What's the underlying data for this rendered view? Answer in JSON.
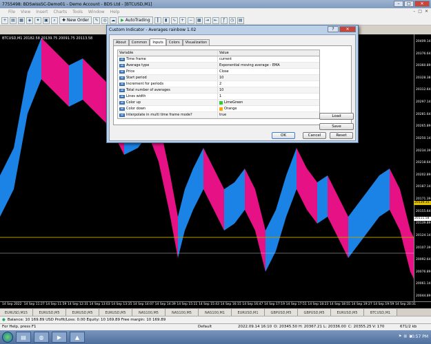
{
  "window": {
    "title": "7755498: BDSwissSC-Demo01 - Demo Account - BDS Ltd - [BTCUSD,M1]"
  },
  "menu": {
    "items": [
      "File",
      "View",
      "Insert",
      "Charts",
      "Tools",
      "Window",
      "Help"
    ]
  },
  "toolbar": {
    "new_order": "New Order",
    "autotrading": "AutoTrading"
  },
  "chart": {
    "label": "BTCUSD,M1  20182.58 20139.75 20091.75 20113.58",
    "price_ticks": [
      "20409.14",
      "20376.64",
      "20360.89",
      "20328.38",
      "20312.64",
      "20297.14",
      "20281.64",
      "20265.89",
      "20250.14",
      "20234.39",
      "20218.64",
      "20202.89",
      "20187.14",
      "20171.39",
      "20155.64",
      "20139.89",
      "20124.14",
      "20107.39",
      "20092.64",
      "20076.89",
      "20061.14",
      "20044.89"
    ],
    "price_tag_yellow": "20139.15",
    "price_tag_white": "20111.58",
    "time_ticks": [
      "14 Sep 2022",
      "14 Sep 11:27",
      "14 Sep 11:59",
      "14 Sep 12:31",
      "14 Sep 13:03",
      "14 Sep 13:35",
      "14 Sep 14:07",
      "14 Sep 14:39",
      "14 Sep 15:11",
      "14 Sep 15:43",
      "14 Sep 16:15",
      "14 Sep 16:47",
      "14 Sep 17:19",
      "14 Sep 17:51",
      "14 Sep 18:23",
      "14 Sep 18:55",
      "14 Sep 19:27",
      "14 Sep 19:59",
      "14 Sep 20:31"
    ],
    "colors": {
      "up": "#1e90ff",
      "down": "#ff1493",
      "yellow_line": "#b8a000"
    }
  },
  "dialog": {
    "title": "Custom Indicator - Averages rainbow 1.02",
    "tabs": [
      "About",
      "Common",
      "Inputs",
      "Colors",
      "Visualization"
    ],
    "active_tab": "Inputs",
    "grid_header": {
      "variable": "Variable",
      "value": "Value"
    },
    "rows": [
      {
        "variable": "Time frame",
        "value": "current"
      },
      {
        "variable": "Average type",
        "value": "Exponential moving average - EMA"
      },
      {
        "variable": "Price",
        "value": "Close"
      },
      {
        "variable": "Start period",
        "value": "10"
      },
      {
        "variable": "Increment for periods",
        "value": "2"
      },
      {
        "variable": "Total number of averages",
        "value": "10"
      },
      {
        "variable": "Lines width",
        "value": "1"
      },
      {
        "variable": "Color up",
        "value": "LimeGreen",
        "color": "#32cd32"
      },
      {
        "variable": "Color down",
        "value": "Orange",
        "color": "#ffa500"
      },
      {
        "variable": "Interpolate in multi time frame mode?",
        "value": "true"
      }
    ],
    "load": "Load",
    "save": "Save",
    "ok": "OK",
    "cancel": "Cancel",
    "reset": "Reset"
  },
  "symbol_tabs": [
    "EURUSD,M15",
    "EURUSD,M5",
    "EURUSD,M5",
    "EURUSD,M5",
    "NAS100,M5",
    "NAS100,M5",
    "NAS100,M1",
    "EURUSD,M1",
    "GBPUSD,M5",
    "GBPUSD,M5",
    "EURUSD,M5",
    "BTCUSD,M1"
  ],
  "balance": {
    "text": "Balance: 10 169.89 USD  Profit/Loss: 0.00  Equity: 10 169.89  Free margin: 10 169.89"
  },
  "status": {
    "help": "For Help, press F1",
    "profile": "Default",
    "datetime": "2022.09.14 16:10",
    "open": "O: 20345.50",
    "high": "H: 20367.21",
    "low": "L: 20336.00",
    "close": "C: 20355.25",
    "volume": "V: 170",
    "traffic": "671/2 kb"
  },
  "taskbar": {
    "clock": "10:57 PM"
  }
}
